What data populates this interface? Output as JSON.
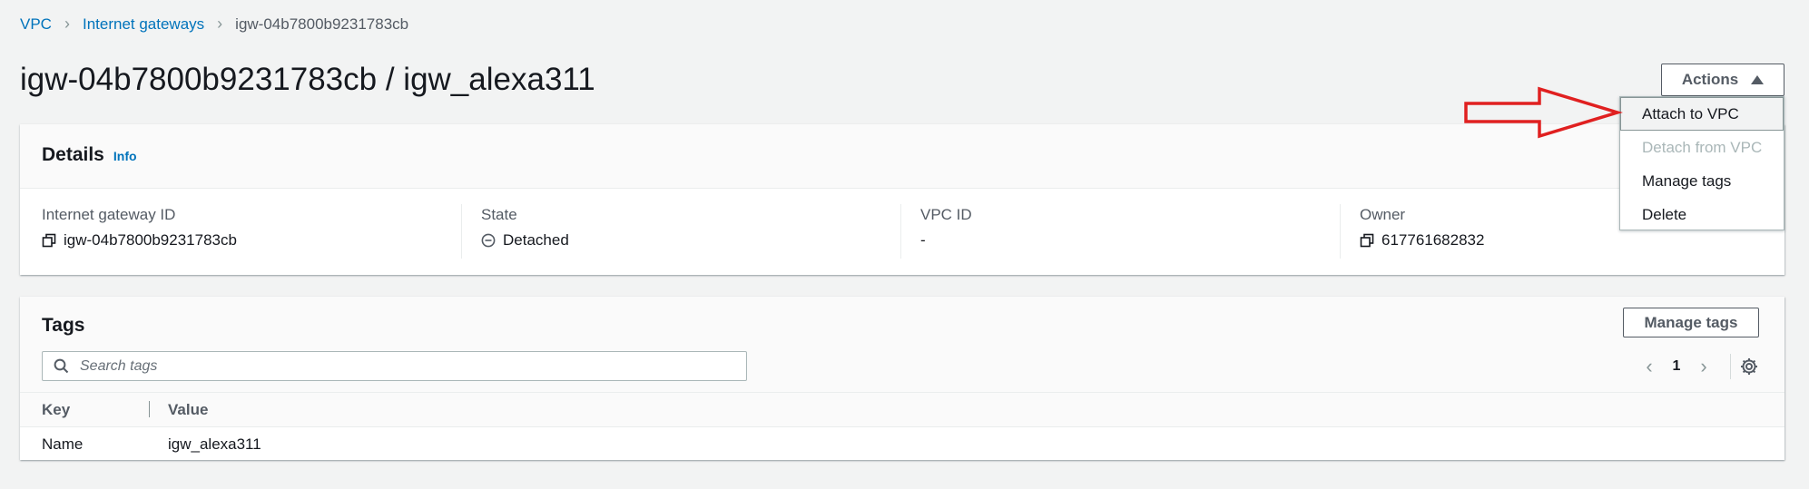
{
  "breadcrumb": {
    "items": [
      "VPC",
      "Internet gateways",
      "igw-04b7800b9231783cb"
    ]
  },
  "page": {
    "title": "igw-04b7800b9231783cb / igw_alexa311"
  },
  "actions": {
    "label": "Actions",
    "menu": [
      {
        "label": "Attach to VPC",
        "state": "highlighted"
      },
      {
        "label": "Detach from VPC",
        "state": "disabled"
      },
      {
        "label": "Manage tags",
        "state": "enabled"
      },
      {
        "label": "Delete",
        "state": "enabled"
      }
    ]
  },
  "details": {
    "title": "Details",
    "info": "Info",
    "fields": [
      {
        "label": "Internet gateway ID",
        "value": "igw-04b7800b9231783cb",
        "icon": "copy-icon"
      },
      {
        "label": "State",
        "value": "Detached",
        "icon": "detached-status-icon"
      },
      {
        "label": "VPC ID",
        "value": "-"
      },
      {
        "label": "Owner",
        "value": "617761682832",
        "icon": "copy-icon"
      }
    ]
  },
  "tags": {
    "title": "Tags",
    "manage_label": "Manage tags",
    "search_placeholder": "Search tags",
    "page_number": "1",
    "columns": [
      "Key",
      "Value"
    ],
    "rows": [
      {
        "key": "Name",
        "value": "igw_alexa311"
      }
    ]
  },
  "colors": {
    "link": "#0073bb",
    "annotation_arrow": "#e02020",
    "background": "#f2f3f3"
  }
}
